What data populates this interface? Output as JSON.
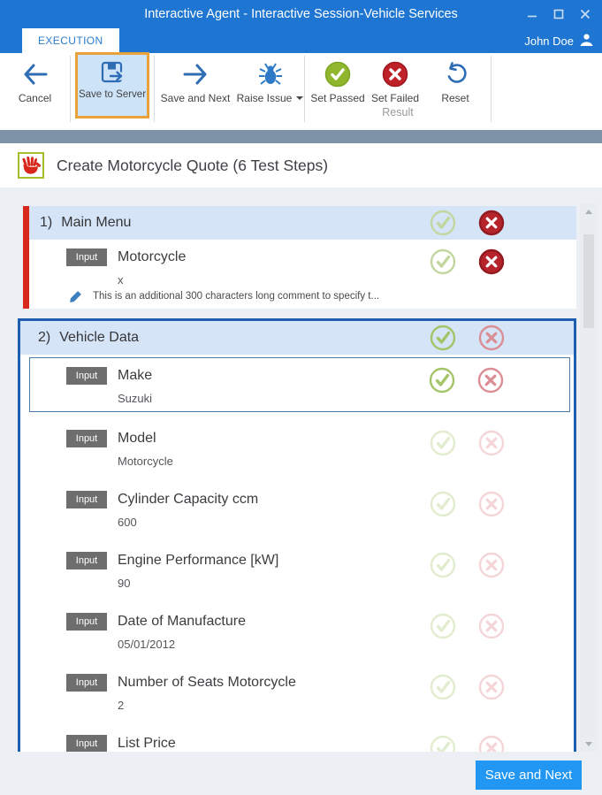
{
  "window": {
    "title": "Interactive Agent - Interactive Session-Vehicle Services",
    "controls": [
      "minimize-icon",
      "maximize-icon",
      "close-icon"
    ],
    "tab_label": "EXECUTION",
    "user_name": "John Doe",
    "user_icon": "person-icon"
  },
  "toolbar": {
    "cancel": {
      "label": "Cancel",
      "icon": "back-arrow-icon"
    },
    "save_to_server": {
      "label": "Save to Server",
      "icon": "save-to-server-icon",
      "highlighted": true
    },
    "save_and_next": {
      "label": "Save and Next",
      "icon": "forward-arrow-icon"
    },
    "raise_issue": {
      "label": "Raise Issue",
      "icon": "bug-icon",
      "has_dropdown": true
    },
    "set_passed": {
      "label": "Set Passed",
      "icon": "green-check-circle-icon"
    },
    "set_failed": {
      "label": "Set Failed",
      "icon": "red-x-circle-icon"
    },
    "reset": {
      "label": "Reset",
      "icon": "undo-icon"
    },
    "group_label": "Result"
  },
  "page_header": {
    "icon": "red-hand-icon",
    "title": "Create Motorcycle Quote (6 Test Steps)"
  },
  "steps": [
    {
      "number": "1)",
      "name": "Main Menu",
      "style": "failed",
      "pass_icon": "light",
      "fail_icon": "solid",
      "rows": [
        {
          "badge": "Input",
          "label": "Motorcycle",
          "value": "x",
          "pass_icon": "light",
          "fail_icon": "solid",
          "comment": "This is an additional 300 characters long comment to specify t..."
        }
      ]
    },
    {
      "number": "2)",
      "name": "Vehicle Data",
      "style": "selected",
      "pass_icon": "medium",
      "fail_icon": "medium",
      "rows": [
        {
          "badge": "Input",
          "label": "Make",
          "value": "Suzuki",
          "pass_icon": "medium",
          "fail_icon": "medium",
          "selected": true
        },
        {
          "badge": "Input",
          "label": "Model",
          "value": "Motorcycle",
          "pass_icon": "faint",
          "fail_icon": "faint"
        },
        {
          "badge": "Input",
          "label": "Cylinder Capacity ccm",
          "value": "600",
          "pass_icon": "faint",
          "fail_icon": "faint"
        },
        {
          "badge": "Input",
          "label": "Engine Performance [kW]",
          "value": "90",
          "pass_icon": "faint",
          "fail_icon": "faint"
        },
        {
          "badge": "Input",
          "label": "Date of Manufacture",
          "value": "05/01/2012",
          "pass_icon": "faint",
          "fail_icon": "faint"
        },
        {
          "badge": "Input",
          "label": "Number of Seats Motorcycle",
          "value": "2",
          "pass_icon": "faint",
          "fail_icon": "faint"
        },
        {
          "badge": "Input",
          "label": "List Price",
          "value": "",
          "pass_icon": "faint",
          "fail_icon": "faint"
        }
      ]
    }
  ],
  "footer": {
    "save_and_next_label": "Save and Next"
  },
  "colors": {
    "titlebar_blue": "#1e76d2",
    "accent_blue": "#2e6db4",
    "selected_border_blue": "#1d5eb0",
    "failed_red_bar": "#d8281c",
    "section_header_bg": "#d5e4f6",
    "passed_green": "#8fb62c",
    "failed_icon_red": "#b6232b",
    "footer_button_blue": "#2196f3",
    "hand_box_border": "#a6bd2c",
    "highlight_border_orange": "#e9a23b"
  }
}
